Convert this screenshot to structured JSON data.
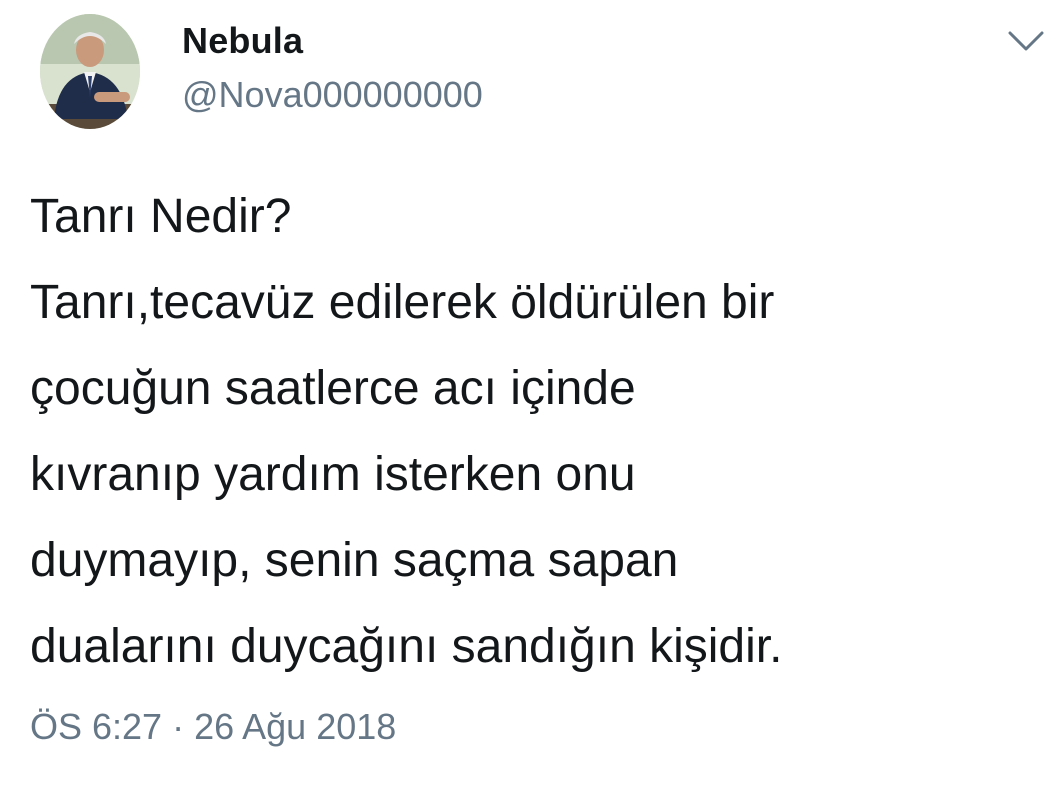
{
  "author": {
    "display_name": "Nebula",
    "handle": "@Nova000000000"
  },
  "menu": {
    "icon": "chevron-down-icon"
  },
  "tweet": {
    "lines": [
      "Tanrı Nedir?",
      "Tanrı,tecavüz edilerek öldürülen bir",
      "çocuğun saatlerce acı içinde",
      "kıvranıp yardım isterken onu",
      "duymayıp, senin saçma sapan",
      "dualarını duycağını sandığın kişidir."
    ],
    "timestamp": "ÖS 6:27 · 26 Ağu 2018"
  },
  "colors": {
    "text": "#14171a",
    "secondary": "#657786",
    "background": "#ffffff"
  }
}
